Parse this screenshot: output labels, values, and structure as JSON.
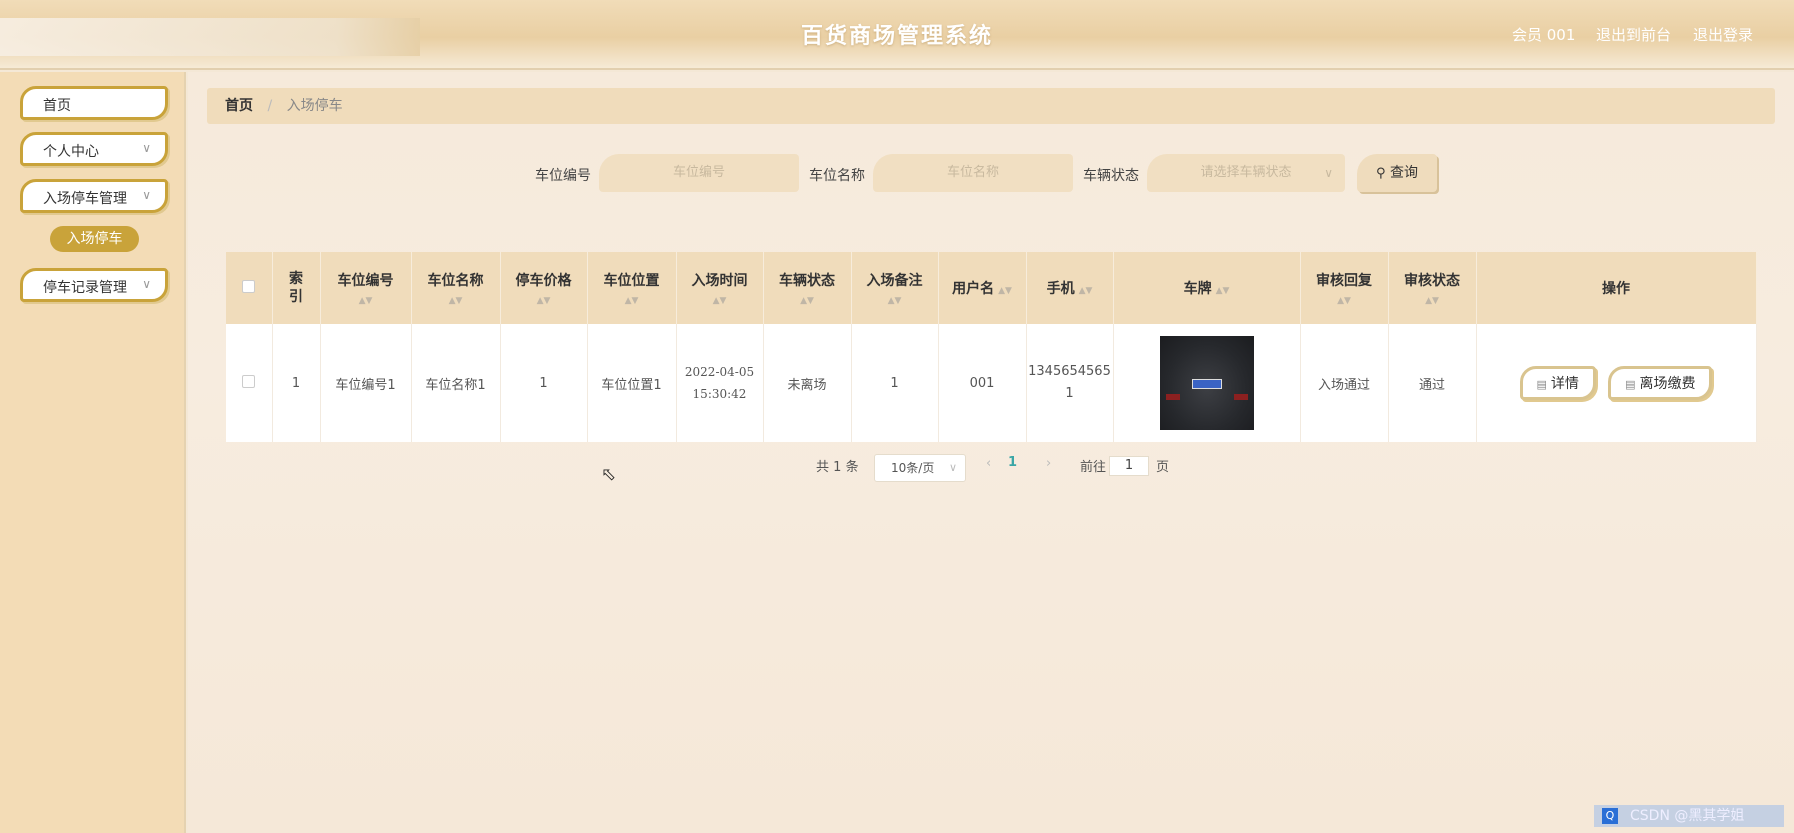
{
  "header": {
    "title": "百货商场管理系统",
    "user": "会员 001",
    "to_front": "退出到前台",
    "logout": "退出登录"
  },
  "sidebar": {
    "items": [
      {
        "label": "首页"
      },
      {
        "label": "个人中心"
      },
      {
        "label": "入场停车管理"
      },
      {
        "label": "停车记录管理"
      }
    ],
    "sub_item": "入场停车",
    "chevron": "∨"
  },
  "breadcrumb": {
    "home": "首页",
    "separator": "/",
    "current": "入场停车"
  },
  "search": {
    "spot_no_label": "车位编号",
    "spot_no_placeholder": "车位编号",
    "spot_name_label": "车位名称",
    "spot_name_placeholder": "车位名称",
    "status_label": "车辆状态",
    "status_placeholder": "请选择车辆状态",
    "button": "查询",
    "button_icon": "search-icon"
  },
  "table": {
    "headers": [
      "索引",
      "车位编号",
      "车位名称",
      "停车价格",
      "车位位置",
      "入场时间",
      "车辆状态",
      "入场备注",
      "用户名",
      "手机",
      "车牌",
      "审核回复",
      "审核状态",
      "操作"
    ],
    "rows": [
      {
        "index": "1",
        "spot_no": "车位编号1",
        "spot_name": "车位名称1",
        "price": "1",
        "location": "车位位置1",
        "entry_date": "2022-04-05",
        "entry_time": "15:30:42",
        "status": "未离场",
        "remark": "1",
        "username": "001",
        "phone_line1": "1345654565",
        "phone_line2": "1",
        "audit_reply": "入场通过",
        "audit_status": "通过",
        "actions": {
          "detail": "详情",
          "pay": "离场缴费"
        }
      }
    ]
  },
  "pagination": {
    "total_prefix": "共",
    "total": "1",
    "total_suffix": "条",
    "page_size": "10条/页",
    "current_page": "1",
    "goto_prefix": "前往",
    "goto_value": "1",
    "goto_suffix": "页"
  },
  "watermark": "CSDN @黑其学姐"
}
